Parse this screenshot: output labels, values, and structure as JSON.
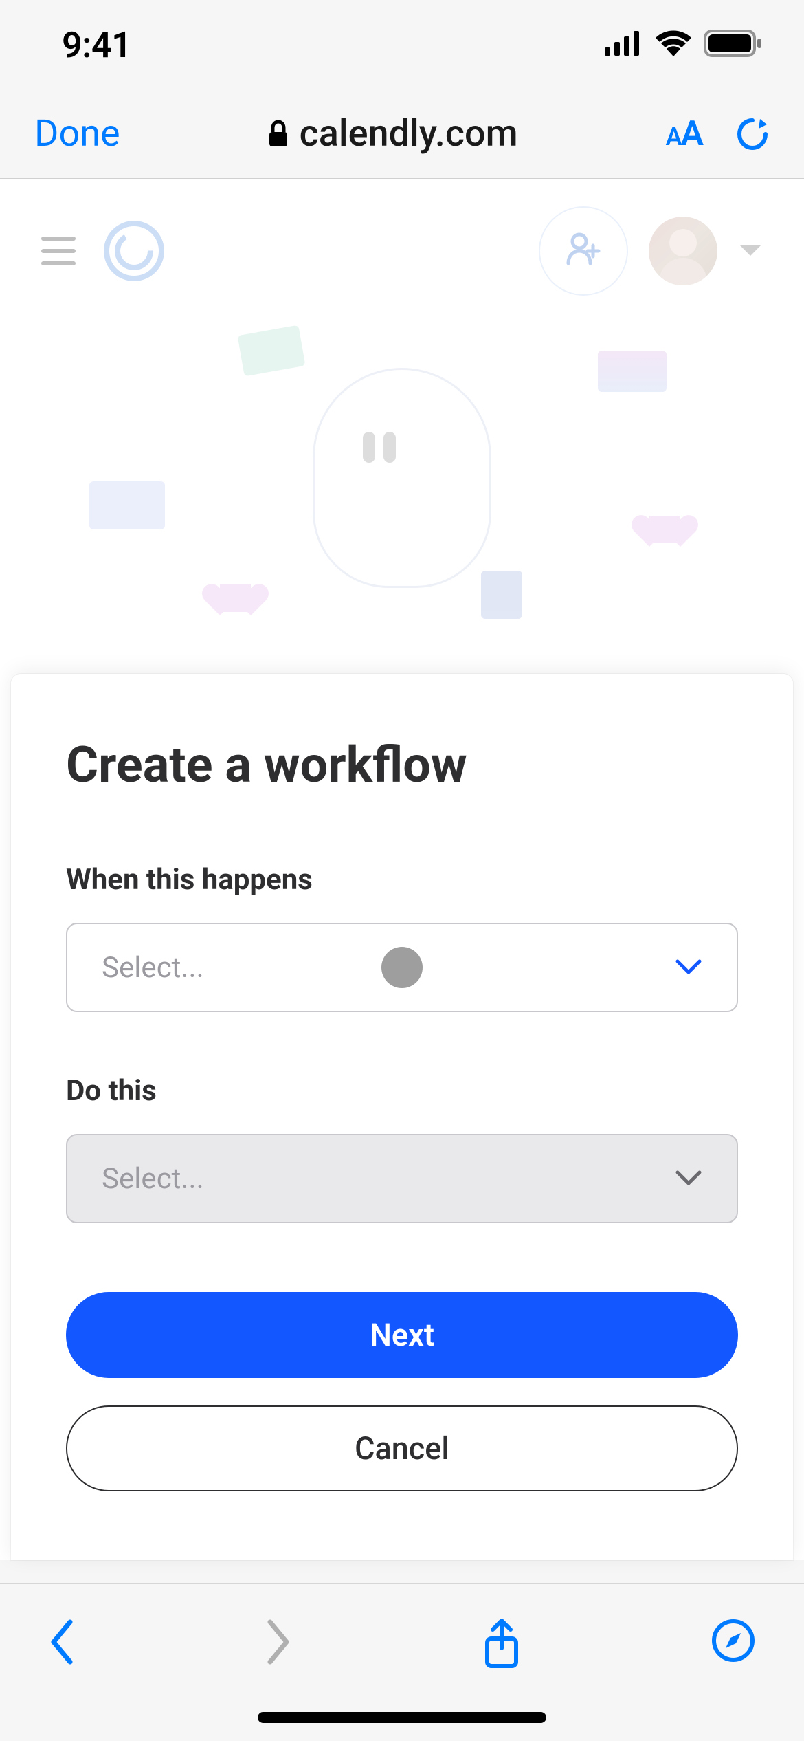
{
  "statusbar": {
    "time": "9:41"
  },
  "safari": {
    "done_label": "Done",
    "domain": "calendly.com",
    "aa_small": "A",
    "aa_large": "A"
  },
  "page": {
    "card_title": "Create a workflow",
    "trigger_label": "When this happens",
    "trigger_placeholder": "Select...",
    "action_label": "Do this",
    "action_placeholder": "Select...",
    "next_label": "Next",
    "cancel_label": "Cancel"
  },
  "colors": {
    "accent": "#1257ff",
    "ios_link": "#007aff"
  }
}
